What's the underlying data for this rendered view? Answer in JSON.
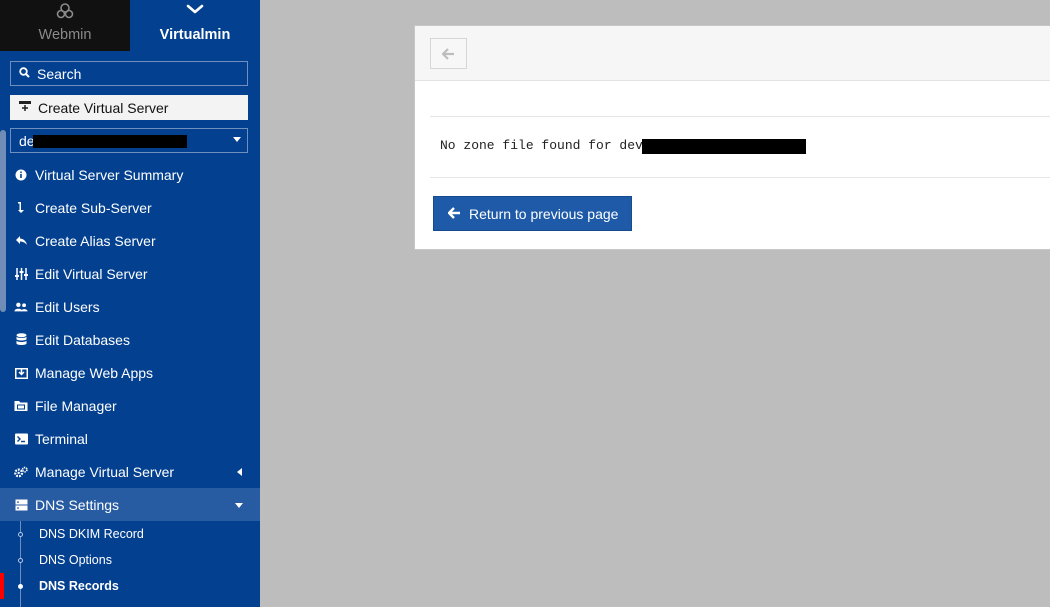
{
  "tabs": {
    "webmin": {
      "label": "Webmin",
      "icon": "webmin-logo-icon"
    },
    "virtualmin": {
      "label": "Virtualmin",
      "icon": "chevron-down-icon"
    }
  },
  "search": {
    "label": "Search"
  },
  "create_virtual_server": {
    "label": "Create Virtual Server"
  },
  "domain_select": {
    "value": "de"
  },
  "menu": [
    {
      "label": "Virtual Server Summary",
      "icon": "info-icon"
    },
    {
      "label": "Create Sub-Server",
      "icon": "arrow-down-icon"
    },
    {
      "label": "Create Alias Server",
      "icon": "reply-icon"
    },
    {
      "label": "Edit Virtual Server",
      "icon": "sliders-icon"
    },
    {
      "label": "Edit Users",
      "icon": "users-icon"
    },
    {
      "label": "Edit Databases",
      "icon": "database-icon"
    },
    {
      "label": "Manage Web Apps",
      "icon": "download-box-icon"
    },
    {
      "label": "File Manager",
      "icon": "folder-icon"
    },
    {
      "label": "Terminal",
      "icon": "terminal-icon"
    },
    {
      "label": "Manage Virtual Server",
      "icon": "cogs-icon"
    },
    {
      "label": "DNS Settings",
      "icon": "server-icon"
    }
  ],
  "dns_submenu": [
    {
      "label": "DNS DKIM Record"
    },
    {
      "label": "DNS Options"
    },
    {
      "label": "DNS Records"
    }
  ],
  "panel": {
    "message": "No zone file found for dev1",
    "return_button": "Return to previous page"
  },
  "colors": {
    "sidebar": "#03408f",
    "active_menu": "#275ca3",
    "primary_button": "#1e5aa8",
    "current_marker": "#ff0000",
    "background": "#bdbdbd"
  }
}
